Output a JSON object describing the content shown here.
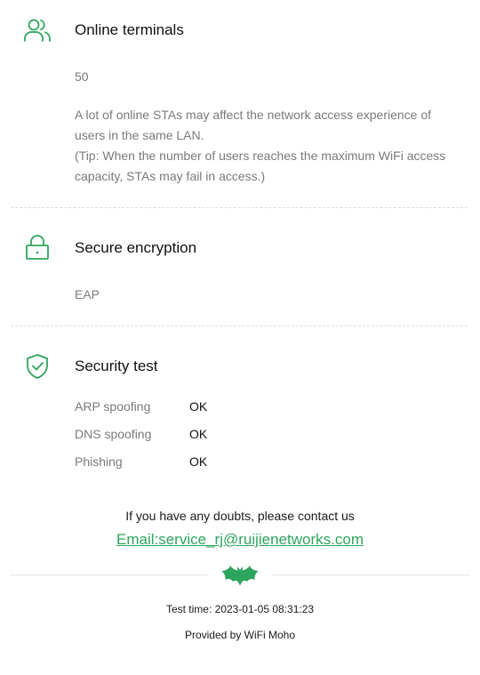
{
  "online": {
    "icon": "users-icon",
    "title": "Online terminals",
    "count": "50",
    "desc_line1": "A lot of online STAs may affect the network access experience of users in the same LAN.",
    "desc_line2": "(Tip: When the number of users reaches the maximum WiFi access capacity, STAs may fail in access.)"
  },
  "encryption": {
    "icon": "lock-icon",
    "title": "Secure encryption",
    "value": "EAP"
  },
  "security": {
    "icon": "shield-check-icon",
    "title": "Security test",
    "rows": [
      {
        "label": "ARP spoofing",
        "status": "OK"
      },
      {
        "label": "DNS spoofing",
        "status": "OK"
      },
      {
        "label": "Phishing",
        "status": "OK"
      }
    ]
  },
  "contact": {
    "text": "If you have any doubts, please contact us",
    "email": "Email:service_rj@ruijienetworks.com"
  },
  "footer": {
    "logo_icon": "bat-logo-icon",
    "test_time": "Test time: 2023-01-05 08:31:23",
    "provided_by": "Provided by WiFi Moho"
  },
  "colors": {
    "accent": "#2ea55d",
    "muted_text": "#7a7a7a",
    "divider": "#dcdcdc"
  }
}
